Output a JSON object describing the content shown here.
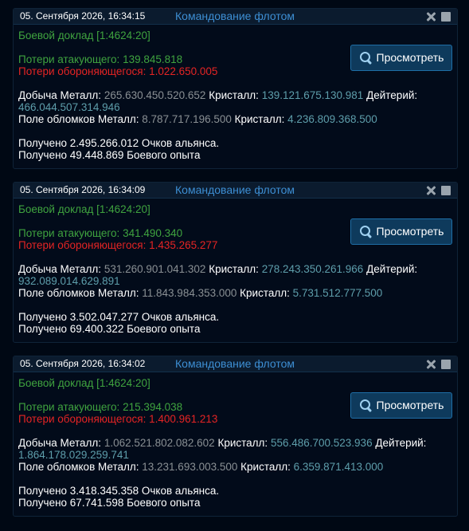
{
  "reports": [
    {
      "date": "05. Сентября 2026, 16:34:15",
      "from": "Командование флотом",
      "title": "Боевой доклад [1:4624:20]",
      "view_label": "Просмотреть",
      "attacker_loss_label": "Потери атакующего:",
      "attacker_loss": "139.845.818",
      "defender_loss_label": "Потери обороняющегося:",
      "defender_loss": "1.022.650.005",
      "loot_metal_label": "Добыча Металл:",
      "loot_metal": "265.630.450.520.652",
      "loot_crystal_label": "Кристалл:",
      "loot_crystal": "139.121.675.130.981",
      "loot_deut_label": "Дейтерий:",
      "loot_deut": "466.044.507.314.946",
      "debris_metal_label": "Поле обломков Металл:",
      "debris_metal": "8.787.717.196.500",
      "debris_crystal_label": "Кристалл:",
      "debris_crystal": "4.236.809.368.500",
      "alliance_points": "Получено 2.495.266.012 Очков альянса.",
      "combat_exp": "Получено 49.448.869 Боевого опыта"
    },
    {
      "date": "05. Сентября 2026, 16:34:09",
      "from": "Командование флотом",
      "title": "Боевой доклад [1:4624:20]",
      "view_label": "Просмотреть",
      "attacker_loss_label": "Потери атакующего:",
      "attacker_loss": "341.490.340",
      "defender_loss_label": "Потери обороняющегося:",
      "defender_loss": "1.435.265.277",
      "loot_metal_label": "Добыча Металл:",
      "loot_metal": "531.260.901.041.302",
      "loot_crystal_label": "Кристалл:",
      "loot_crystal": "278.243.350.261.966",
      "loot_deut_label": "Дейтерий:",
      "loot_deut": "932.089.014.629.891",
      "debris_metal_label": "Поле обломков Металл:",
      "debris_metal": "11.843.984.353.000",
      "debris_crystal_label": "Кристалл:",
      "debris_crystal": "5.731.512.777.500",
      "alliance_points": "Получено 3.502.047.277 Очков альянса.",
      "combat_exp": "Получено 69.400.322 Боевого опыта"
    },
    {
      "date": "05. Сентября 2026, 16:34:02",
      "from": "Командование флотом",
      "title": "Боевой доклад [1:4624:20]",
      "view_label": "Просмотреть",
      "attacker_loss_label": "Потери атакующего:",
      "attacker_loss": "215.394.038",
      "defender_loss_label": "Потери обороняющегося:",
      "defender_loss": "1.400.961.213",
      "loot_metal_label": "Добыча Металл:",
      "loot_metal": "1.062.521.802.082.602",
      "loot_crystal_label": "Кристалл:",
      "loot_crystal": "556.486.700.523.936",
      "loot_deut_label": "Дейтерий:",
      "loot_deut": "1.864.178.029.259.741",
      "debris_metal_label": "Поле обломков Металл:",
      "debris_metal": "13.231.693.003.500",
      "debris_crystal_label": "Кристалл:",
      "debris_crystal": "6.359.871.413.000",
      "alliance_points": "Получено 3.418.345.358 Очков альянса.",
      "combat_exp": "Получено 67.741.598 Боевого опыта"
    }
  ],
  "icons": {
    "delete": "close-icon",
    "select": "checkbox-icon",
    "view": "magnifier-icon"
  },
  "colors": {
    "background": "#000814",
    "header": "#0b1b2e",
    "sender": "#3d8ed3",
    "green": "#3fa33f",
    "red": "#e52424",
    "value": "#5e9eab",
    "button": "#0e3a5c"
  }
}
